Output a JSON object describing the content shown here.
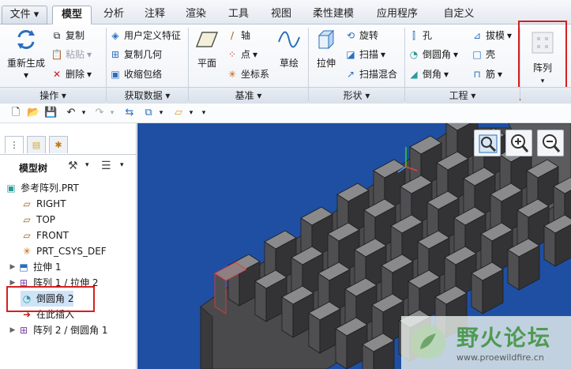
{
  "tabs": {
    "file": "文件",
    "items": [
      "模型",
      "分析",
      "注释",
      "渲染",
      "工具",
      "视图",
      "柔性建模",
      "应用程序",
      "自定义"
    ]
  },
  "ribbon": {
    "regenerate": "重新生成",
    "copy": "复制",
    "paste": "粘贴",
    "delete": "删除",
    "user_feature": "用户定义特征",
    "copy_geometry": "复制几何",
    "shrinkwrap": "收缩包络",
    "plane": "平面",
    "axis": "轴",
    "point": "点",
    "csys": "坐标系",
    "sketch": "草绘",
    "extrude": "拉伸",
    "revolve": "旋转",
    "sweep": "扫描",
    "swept_blend": "扫描混合",
    "hole": "孔",
    "round": "倒圆角",
    "chamfer": "倒角",
    "draft": "拔模",
    "shell": "壳",
    "rib": "筋",
    "pattern": "阵列",
    "groups": {
      "operations": "操作",
      "get_data": "获取数据",
      "datum": "基准",
      "shapes": "形状",
      "engineering": "工程"
    }
  },
  "panel": {
    "model_tree": "模型树"
  },
  "tree": {
    "root": "参考阵列.PRT",
    "items": [
      "RIGHT",
      "TOP",
      "FRONT",
      "PRT_CSYS_DEF",
      "拉伸 1",
      "阵列 1 / 拉伸 2",
      "倒圆角 2",
      "在此插入",
      "阵列 2 / 倒圆角 1"
    ]
  },
  "watermark": {
    "title": "野火论坛",
    "url": "www.proewildfire.cn"
  },
  "colors": {
    "viewport_bg": "#1e4fa2",
    "highlight": "#d42020"
  }
}
